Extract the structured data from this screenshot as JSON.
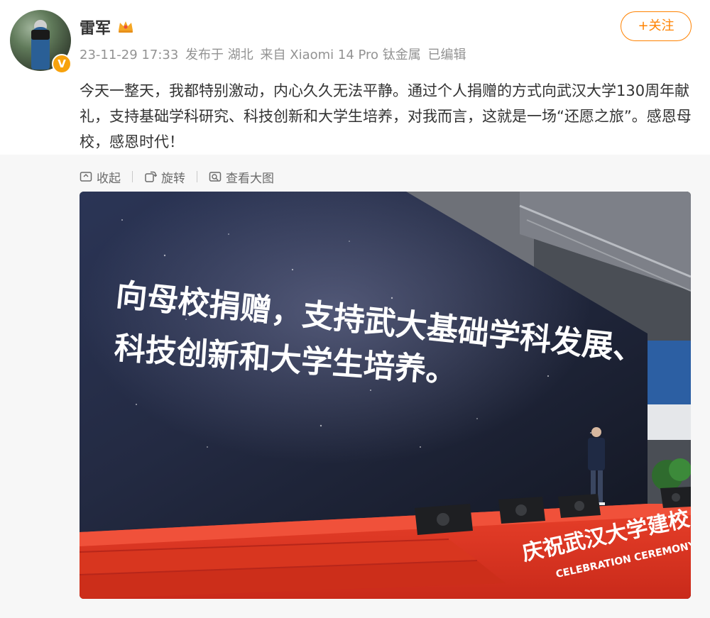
{
  "user": {
    "name": "雷军",
    "verified_mark": "V"
  },
  "meta": {
    "time": "23-11-29 17:33",
    "location": "发布于 湖北",
    "source": "来自 Xiaomi 14 Pro 钛金属",
    "edited": "已编辑"
  },
  "follow_label": "+关注",
  "post": {
    "text": "今天一整天，我都特别激动，内心久久无法平静。通过个人捐赠的方式向武汉大学130周年献礼，支持基础学科研究、科技创新和大学生培养，对我而言，这就是一场“还愿之旅”。感恩母校，感恩时代！"
  },
  "media_toolbar": {
    "collapse_label": "收起",
    "rotate_label": "旋转",
    "view_large_label": "查看大图"
  },
  "photo": {
    "screen_line1": "向母校捐赠，支持武大基础学科发展、",
    "screen_line2": "科技创新和大学生培养。",
    "stage_banner_cn": "庆祝武汉大学建校",
    "stage_banner_en": "CELEBRATION CEREMONY OF WU"
  },
  "colors": {
    "accent": "#ff8200",
    "badge": "#f7a20d",
    "stage_red": "#e0301e"
  },
  "icons": [
    "crown-icon",
    "collapse-icon",
    "rotate-icon",
    "view-large-icon"
  ]
}
